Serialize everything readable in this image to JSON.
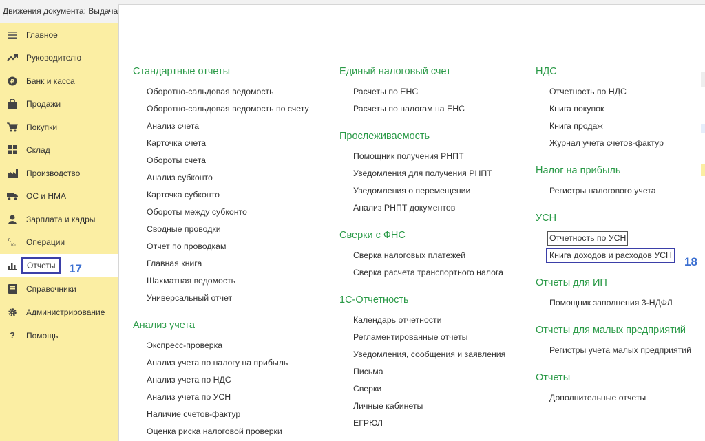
{
  "window": {
    "title": "Движения документа: Выдача"
  },
  "sidebar": {
    "items": [
      {
        "label": "Главное",
        "icon": "menu-lines-icon"
      },
      {
        "label": "Руководителю",
        "icon": "trend-icon"
      },
      {
        "label": "Банк и касса",
        "icon": "coin-icon"
      },
      {
        "label": "Продажи",
        "icon": "bag-icon"
      },
      {
        "label": "Покупки",
        "icon": "cart-icon"
      },
      {
        "label": "Склад",
        "icon": "warehouse-grid-icon"
      },
      {
        "label": "Производство",
        "icon": "factory-icon"
      },
      {
        "label": "ОС и НМА",
        "icon": "truck-icon"
      },
      {
        "label": "Зарплата и кадры",
        "icon": "person-icon"
      },
      {
        "label": "Операции",
        "icon": "dt-kt-icon"
      },
      {
        "label": "Отчеты",
        "icon": "bar-chart-icon"
      },
      {
        "label": "Справочники",
        "icon": "book-icon"
      },
      {
        "label": "Администрирование",
        "icon": "gear-icon"
      },
      {
        "label": "Помощь",
        "icon": "question-icon"
      }
    ],
    "active_badge": "17",
    "dtkt_top": "Дт",
    "dtkt_bottom": "Кт"
  },
  "columns": [
    {
      "sections": [
        {
          "title": "Стандартные отчеты",
          "links": [
            "Оборотно-сальдовая ведомость",
            "Оборотно-сальдовая ведомость по счету",
            "Анализ счета",
            "Карточка счета",
            "Обороты счета",
            "Анализ субконто",
            "Карточка субконто",
            "Обороты между субконто",
            "Сводные проводки",
            "Отчет по проводкам",
            "Главная книга",
            "Шахматная ведомость",
            "Универсальный отчет"
          ]
        },
        {
          "title": "Анализ учета",
          "links": [
            "Экспресс-проверка",
            "Анализ учета по налогу на прибыль",
            "Анализ учета по НДС",
            "Анализ учета по УСН",
            "Наличие счетов-фактур",
            "Оценка риска налоговой проверки"
          ]
        }
      ]
    },
    {
      "sections": [
        {
          "title": "Единый налоговый счет",
          "links": [
            "Расчеты по ЕНС",
            "Расчеты по налогам на ЕНС"
          ]
        },
        {
          "title": "Прослеживаемость",
          "links": [
            "Помощник получения РНПТ",
            "Уведомления для получения РНПТ",
            "Уведомления о перемещении",
            "Анализ РНПТ документов"
          ]
        },
        {
          "title": "Сверки с ФНС",
          "links": [
            "Сверка налоговых платежей",
            "Сверка расчета транспортного налога"
          ]
        },
        {
          "title": "1С-Отчетность",
          "links": [
            "Календарь отчетности",
            "Регламентированные отчеты",
            "Уведомления, сообщения и заявления",
            "Письма",
            "Сверки",
            "Личные кабинеты",
            "ЕГРЮЛ"
          ]
        }
      ]
    },
    {
      "sections": [
        {
          "title": "НДС",
          "links": [
            "Отчетность по НДС",
            "Книга покупок",
            "Книга продаж",
            "Журнал учета счетов-фактур"
          ]
        },
        {
          "title": "Налог на прибыль",
          "links": [
            "Регистры налогового учета"
          ]
        },
        {
          "title": "УСН",
          "links": [
            "Отчетность по УСН",
            "Книга доходов и расходов УСН"
          ]
        },
        {
          "title": "Отчеты для ИП",
          "links": [
            "Помощник заполнения 3-НДФЛ"
          ]
        },
        {
          "title": "Отчеты для малых предприятий",
          "links": [
            "Регистры учета малых предприятий"
          ]
        },
        {
          "title": "Отчеты",
          "links": [
            "Дополнительные отчеты"
          ]
        }
      ]
    }
  ],
  "highlight_badge": "18",
  "colors": {
    "sidebar_bg": "#fbeea3",
    "section_title": "#2a9a47",
    "highlight_box": "#3b3fa8",
    "badge": "#3b6fd1"
  }
}
